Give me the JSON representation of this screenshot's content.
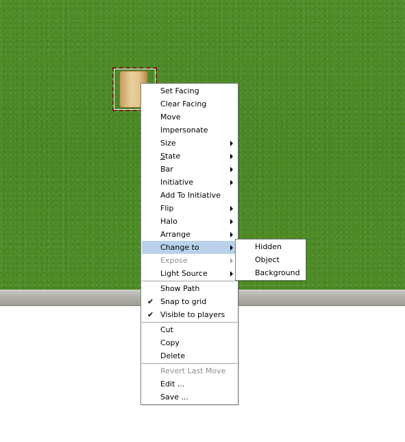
{
  "main_menu": {
    "groups": [
      [
        {
          "label": "Set Facing"
        },
        {
          "label": "Clear Facing"
        },
        {
          "label": "Move"
        },
        {
          "label": "Impersonate"
        },
        {
          "label": "Size",
          "submenu": true
        },
        {
          "label": "State",
          "submenu": true,
          "mnemonic": "S"
        },
        {
          "label": "Bar",
          "submenu": true
        },
        {
          "label": "Initiative",
          "submenu": true
        },
        {
          "label": "Add To Initiative"
        },
        {
          "label": "Flip",
          "submenu": true
        },
        {
          "label": "Halo",
          "submenu": true
        },
        {
          "label": "Arrange",
          "submenu": true
        },
        {
          "label": "Change to",
          "submenu": true,
          "highlighted": true
        },
        {
          "label": "Expose",
          "submenu": true,
          "disabled": true
        },
        {
          "label": "Light Source",
          "submenu": true
        }
      ],
      [
        {
          "label": "Show Path"
        },
        {
          "label": "Snap to grid",
          "checked": true
        },
        {
          "label": "Visible to players",
          "checked": true
        }
      ],
      [
        {
          "label": "Cut"
        },
        {
          "label": "Copy"
        },
        {
          "label": "Delete"
        }
      ],
      [
        {
          "label": "Revert Last Move",
          "disabled": true
        },
        {
          "label": "Edit ..."
        },
        {
          "label": "Save ..."
        }
      ]
    ]
  },
  "change_to_submenu": {
    "items": [
      {
        "label": "Hidden"
      },
      {
        "label": "Object"
      },
      {
        "label": "Background"
      }
    ]
  },
  "colors": {
    "highlight": "#b9d1ea",
    "grass": "#4d8a26",
    "selection_border": "#7a1a1a"
  }
}
